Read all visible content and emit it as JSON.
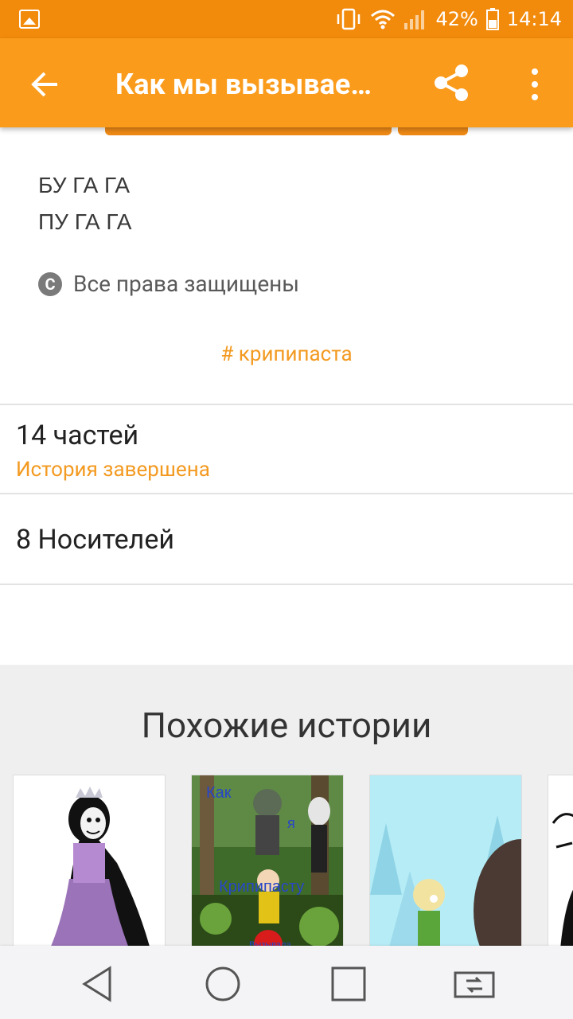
{
  "status_bar": {
    "battery": "42%",
    "time": "14:14"
  },
  "app_bar": {
    "title": "Как мы вызываем Крипипасту",
    "back_icon": "arrow-back-icon",
    "share_icon": "share-icon",
    "more_icon": "more-vert-icon"
  },
  "story": {
    "description_lines": [
      "БУ ГА ГА",
      "ПУ ГА ГА"
    ],
    "rights": "Все права защищены",
    "tag": "# крипипаста"
  },
  "parts": {
    "count": "14 частей",
    "status": "История завершена"
  },
  "carriers": {
    "label": "8 Носителей"
  },
  "similar": {
    "heading": "Похожие истории",
    "card2_overlay": [
      "Как",
      "я",
      "Крипипасту",
      "Вызывала"
    ]
  },
  "colors": {
    "status_bar": "#f28a0c",
    "app_bar": "#fa9b1b",
    "accent": "#f39a21"
  }
}
